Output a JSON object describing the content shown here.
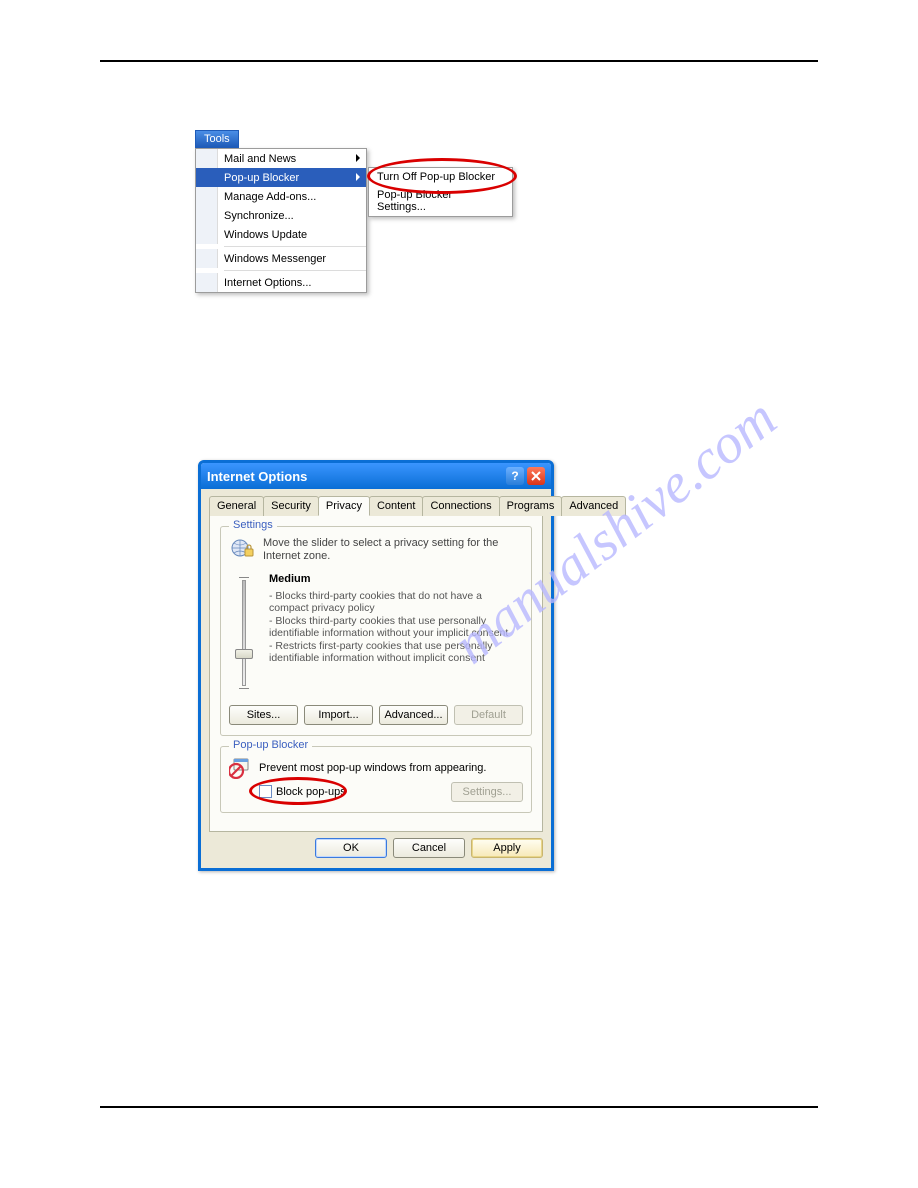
{
  "watermark": "manualshive.com",
  "tools_menu": {
    "header": "Tools",
    "items": [
      {
        "label": "Mail and News",
        "has_submenu": true,
        "highlighted": false
      },
      {
        "label": "Pop-up Blocker",
        "has_submenu": true,
        "highlighted": true
      },
      {
        "label": "Manage Add-ons...",
        "has_submenu": false,
        "highlighted": false
      },
      {
        "label": "Synchronize...",
        "has_submenu": false,
        "highlighted": false
      },
      {
        "label": "Windows Update",
        "has_submenu": false,
        "highlighted": false
      }
    ],
    "items_group2": [
      {
        "label": "Windows Messenger"
      }
    ],
    "items_group3": [
      {
        "label": "Internet Options..."
      }
    ],
    "submenu": {
      "items": [
        {
          "label": "Turn Off Pop-up Blocker"
        },
        {
          "label": "Pop-up Blocker Settings..."
        }
      ]
    }
  },
  "dialog": {
    "title": "Internet Options",
    "tabs": [
      "General",
      "Security",
      "Privacy",
      "Content",
      "Connections",
      "Programs",
      "Advanced"
    ],
    "active_tab": "Privacy",
    "settings_group": {
      "legend": "Settings",
      "intro": "Move the slider to select a privacy setting for the Internet zone.",
      "level_name": "Medium",
      "bullets": [
        "- Blocks third-party cookies that do not have a compact privacy policy",
        "- Blocks third-party cookies that use personally identifiable information without your implicit consent",
        "- Restricts first-party cookies that use personally identifiable information without implicit consent"
      ],
      "buttons": {
        "sites": "Sites...",
        "import": "Import...",
        "advanced": "Advanced...",
        "default": "Default"
      }
    },
    "popup_group": {
      "legend": "Pop-up Blocker",
      "description": "Prevent most pop-up windows from appearing.",
      "checkbox_label": "Block pop-ups",
      "checkbox_checked": false,
      "settings_btn": "Settings..."
    },
    "bottom_buttons": {
      "ok": "OK",
      "cancel": "Cancel",
      "apply": "Apply"
    }
  }
}
